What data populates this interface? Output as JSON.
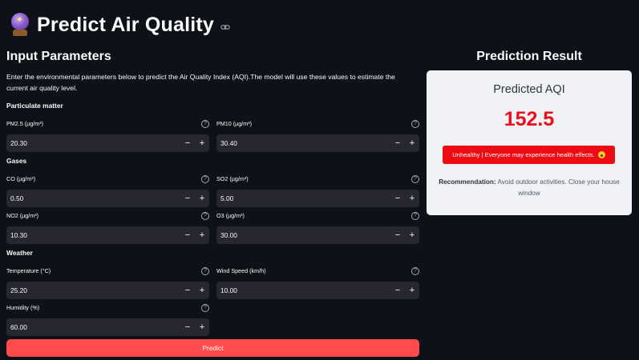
{
  "header": {
    "title": "Predict Air Quality",
    "icon": "crystal-ball-icon",
    "link_icon": "link-icon"
  },
  "input": {
    "heading": "Input Parameters",
    "description": "Enter the environmental parameters below to predict the Air Quality Index (AQI).The model will use these values to estimate the current air quality level.",
    "groups": {
      "particulate": "Particulate matter",
      "gases": "Gases",
      "weather": "Weather"
    },
    "fields": {
      "pm25": {
        "label": "PM2.5 (µg/m³)",
        "value": "20.30"
      },
      "pm10": {
        "label": "PM10 (µg/m³)",
        "value": "30.40"
      },
      "co": {
        "label": "CO (µg/m³)",
        "value": "0.50"
      },
      "so2": {
        "label": "SO2 (µg/m³)",
        "value": "5.00"
      },
      "no2": {
        "label": "NO2 (µg/m³)",
        "value": "10.30"
      },
      "o3": {
        "label": "O3 (µg/m³)",
        "value": "30.00"
      },
      "temperature": {
        "label": "Temperature (°C)",
        "value": "25.20"
      },
      "wind": {
        "label": "Wind Speed (km/h)",
        "value": "10.00"
      },
      "humidity": {
        "label": "Humidity (%)",
        "value": "60.00"
      }
    },
    "minus": "−",
    "plus": "+",
    "help": "?",
    "predict_label": "Predict"
  },
  "result": {
    "heading": "Prediction Result",
    "card_title": "Predicted AQI",
    "value": "152.5",
    "status": "Unhealthy | Everyone may experience health effects.",
    "recommendation_label": "Recommendation:",
    "recommendation_text": " Avoid outdoor activities. Close your house window"
  },
  "colors": {
    "background": "#0e1117",
    "input_bg": "#262730",
    "accent": "#ff4b4b",
    "card_bg": "#f0f2f6",
    "aqi_value": "#e8101a",
    "status_badge": "#ee0c14"
  }
}
